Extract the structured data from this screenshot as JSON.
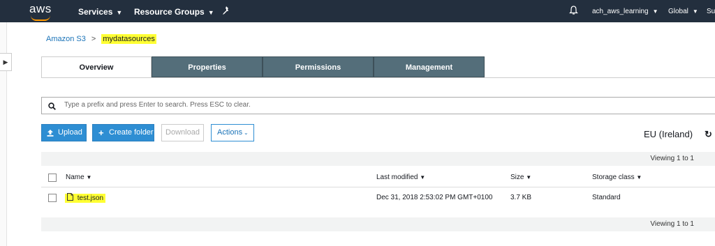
{
  "topnav": {
    "logo": "aws",
    "services": "Services",
    "resource_groups": "Resource Groups",
    "account": "ach_aws_learning",
    "region_menu": "Global",
    "support_partial": "Su"
  },
  "breadcrumb": {
    "root": "Amazon S3",
    "sep": ">",
    "current": "mydatasources"
  },
  "tabs": [
    "Overview",
    "Properties",
    "Permissions",
    "Management"
  ],
  "search": {
    "placeholder": "Type a prefix and press Enter to search. Press ESC to clear."
  },
  "toolbar": {
    "upload": "Upload",
    "create_folder": "Create folder",
    "download": "Download",
    "actions": "Actions",
    "region": "EU (Ireland)"
  },
  "table": {
    "viewing_top": "Viewing 1 to 1",
    "viewing_bottom": "Viewing 1 to 1",
    "headers": {
      "name": "Name",
      "last_modified": "Last modified",
      "size": "Size",
      "storage_class": "Storage class"
    },
    "rows": [
      {
        "name": "test.json",
        "last_modified": "Dec 31, 2018 2:53:02 PM GMT+0100",
        "size": "3.7 KB",
        "storage_class": "Standard"
      }
    ]
  },
  "colors": {
    "nav_bg": "#232f3e",
    "tab_bg": "#546e7a",
    "primary": "#2e8ed3",
    "highlight": "#ffff33"
  }
}
